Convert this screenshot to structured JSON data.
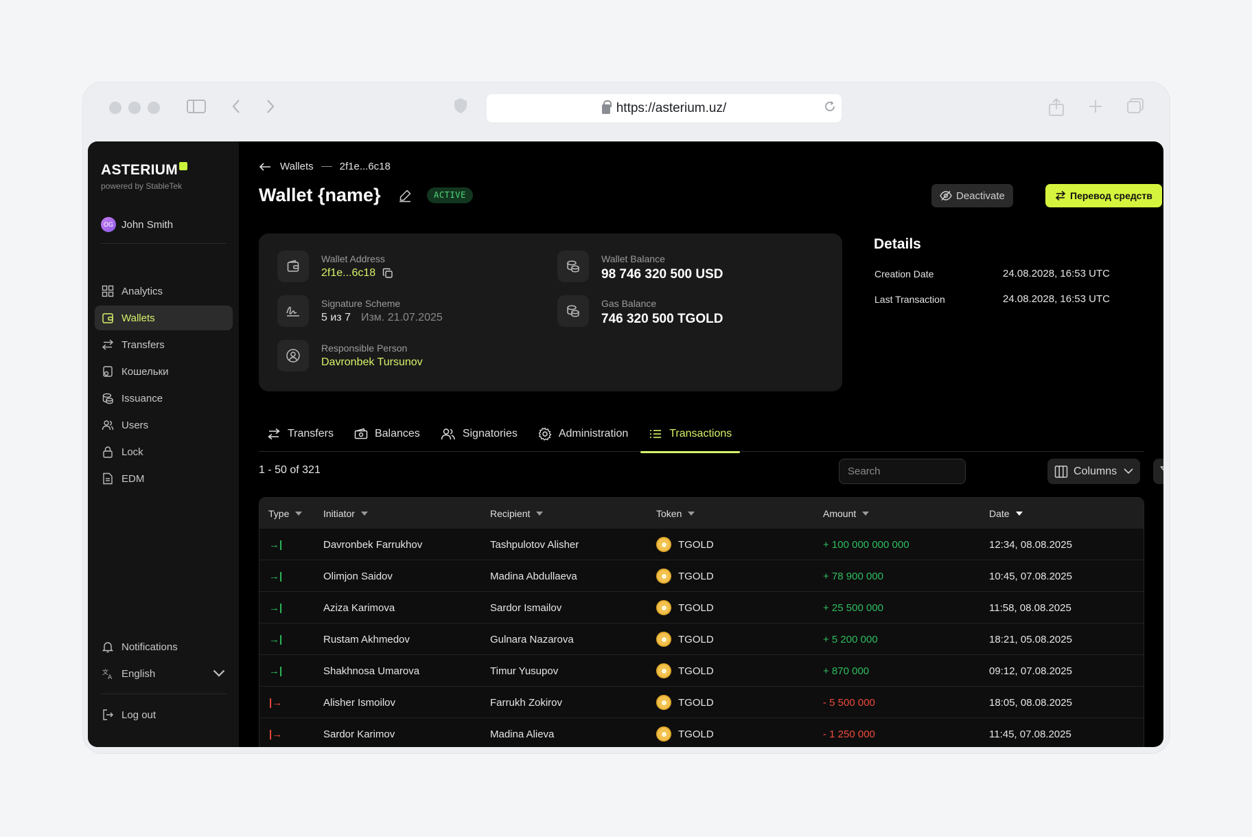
{
  "browser": {
    "url": "https://asterium.uz/"
  },
  "sidebar": {
    "logo": "ASTERIUM",
    "powered": "powered by StableTek",
    "user": {
      "name": "John Smith",
      "initials": "OG"
    },
    "items": [
      {
        "label": "Analytics",
        "icon": "grid-icon"
      },
      {
        "label": "Wallets",
        "icon": "wallet-icon",
        "active": true
      },
      {
        "label": "Transfers",
        "icon": "arrows-icon"
      },
      {
        "label": "Кошельки",
        "icon": "wallet-key-icon"
      },
      {
        "label": "Issuance",
        "icon": "coins-icon"
      },
      {
        "label": "Users",
        "icon": "users-icon"
      },
      {
        "label": "Lock",
        "icon": "lock-icon"
      },
      {
        "label": "EDM",
        "icon": "document-icon"
      }
    ],
    "notifications": "Notifications",
    "language": "English",
    "logout": "Log out"
  },
  "header": {
    "breadcrumb_root": "Wallets",
    "breadcrumb_current": "2f1e...6c18",
    "title": "Wallet {name}",
    "status": "ACTIVE",
    "deactivate_label": "Deactivate",
    "transfer_label": "Перевод средств"
  },
  "wallet": {
    "address_label": "Wallet Address",
    "address": "2f1e...6c18",
    "signature_label": "Signature Scheme",
    "signature_value": "5 из 7",
    "signature_changed": "Изм. 21.07.2025",
    "responsible_label": "Responsible Person",
    "responsible": "Davronbek Tursunov",
    "balance_label": "Wallet Balance",
    "balance": "98 746 320 500 USD",
    "gas_label": "Gas Balance",
    "gas": "746 320 500 TGOLD"
  },
  "details": {
    "title": "Details",
    "creation_label": "Creation Date",
    "creation": "24.08.2028, 16:53 UTC",
    "last_tx_label": "Last Transaction",
    "last_tx": "24.08.2028, 16:53 UTC"
  },
  "tabs": [
    {
      "label": "Transfers",
      "icon": "arrows-icon"
    },
    {
      "label": "Balances",
      "icon": "cash-icon"
    },
    {
      "label": "Signatories",
      "icon": "users-icon"
    },
    {
      "label": "Administration",
      "icon": "gear-icon"
    },
    {
      "label": "Transactions",
      "icon": "list-icon",
      "active": true
    }
  ],
  "toolbar": {
    "count": "1 - 50 of 321",
    "search_placeholder": "Search",
    "columns_label": "Columns",
    "filter_label": "filter"
  },
  "table": {
    "columns": [
      "Type",
      "Initiator",
      "Recipient",
      "Token",
      "Amount",
      "Date"
    ],
    "rows": [
      {
        "type": "in",
        "initiator": "Davronbek Farrukhov",
        "recipient": "Tashpulotov Alisher",
        "token": "TGOLD",
        "amount": "+ 100 000 000 000",
        "date": "12:34, 08.08.2025"
      },
      {
        "type": "in",
        "initiator": "Olimjon Saidov",
        "recipient": "Madina Abdullaeva",
        "token": "TGOLD",
        "amount": "+ 78 900 000",
        "date": "10:45, 07.08.2025"
      },
      {
        "type": "in",
        "initiator": "Aziza Karimova",
        "recipient": "Sardor Ismailov",
        "token": "TGOLD",
        "amount": "+ 25 500 000",
        "date": "11:58, 08.08.2025"
      },
      {
        "type": "in",
        "initiator": "Rustam Akhmedov",
        "recipient": "Gulnara Nazarova",
        "token": "TGOLD",
        "amount": "+ 5 200 000",
        "date": "18:21, 05.08.2025"
      },
      {
        "type": "in",
        "initiator": "Shakhnosa Umarova",
        "recipient": "Timur Yusupov",
        "token": "TGOLD",
        "amount": "+ 870 000",
        "date": "09:12, 07.08.2025"
      },
      {
        "type": "out",
        "initiator": "Alisher Ismoilov",
        "recipient": "Farrukh Zokirov",
        "token": "TGOLD",
        "amount": "- 5 500 000",
        "date": "18:05, 08.08.2025"
      },
      {
        "type": "out",
        "initiator": "Sardor Karimov",
        "recipient": "Madina Alieva",
        "token": "TGOLD",
        "amount": "- 1 250 000",
        "date": "11:45, 07.08.2025"
      }
    ]
  },
  "colors": {
    "accent": "#d6f26a",
    "button_accent": "#d5f43d",
    "incoming": "#2ebd5f",
    "outgoing": "#ef4a3c",
    "active_badge": "#52d67c"
  }
}
